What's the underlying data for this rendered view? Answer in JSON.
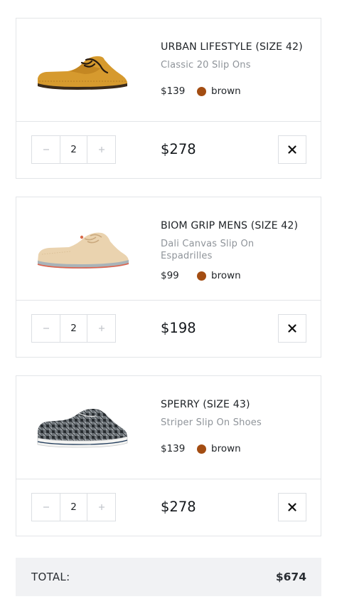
{
  "cart": {
    "items": [
      {
        "name": "URBAN LIFESTYLE (SIZE 42)",
        "subtitle": "Classic 20 Slip Ons",
        "price": "$139",
        "color_name": "brown",
        "quantity": "2",
        "line_total": "$278",
        "image_icon": "shoe-urban-lifestyle-image"
      },
      {
        "name": "BIOM GRIP MENS (SIZE 42)",
        "subtitle": "Dali Canvas Slip On Espadrilles",
        "price": "$99",
        "color_name": "brown",
        "quantity": "2",
        "line_total": "$198",
        "image_icon": "shoe-biom-grip-image"
      },
      {
        "name": "SPERRY (SIZE 43)",
        "subtitle": "Striper Slip On Shoes",
        "price": "$139",
        "color_name": "brown",
        "quantity": "2",
        "line_total": "$278",
        "image_icon": "shoe-sperry-image"
      }
    ],
    "decrement_icon": "minus-icon",
    "increment_icon": "plus-icon",
    "remove_icon": "close-icon",
    "swatch_color": "#a34d12"
  },
  "total": {
    "label": "TOTAL:",
    "value": "$674"
  }
}
